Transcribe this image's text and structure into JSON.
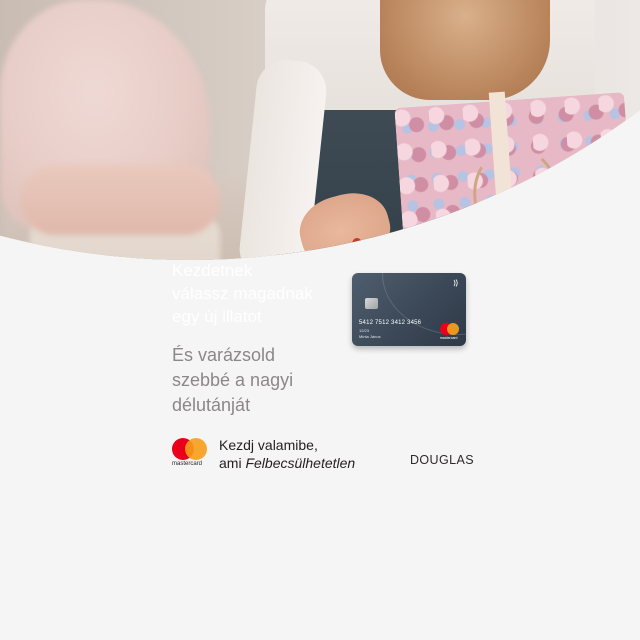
{
  "headline": {
    "line1": "Kezdetnek",
    "line2": "válassz magadnak",
    "line3": "egy új illatot"
  },
  "subline": {
    "line1": "És varázsold",
    "line2": "szebbé a nagyi",
    "line3": "délutánját"
  },
  "card": {
    "number": "5412 7512 3412 3456",
    "expiry": "12/23",
    "holder": "Minta János",
    "brand": "mastercard"
  },
  "footer": {
    "logo_word": "mastercard",
    "tagline_line1": "Kezdj valamibe,",
    "tagline_line2_prefix": "ami ",
    "tagline_line2_italic": "Felbecsülhetetlen",
    "partner": "DOUGLAS"
  },
  "colors": {
    "background": "#f6f5f5",
    "headline": "#ffffff",
    "subline": "#8c8789",
    "mc_red": "#eb001b",
    "mc_yellow": "#f79e1b",
    "card": "#3b4858"
  },
  "icons": {
    "contactless": "contactless-icon",
    "chip": "chip-icon"
  }
}
